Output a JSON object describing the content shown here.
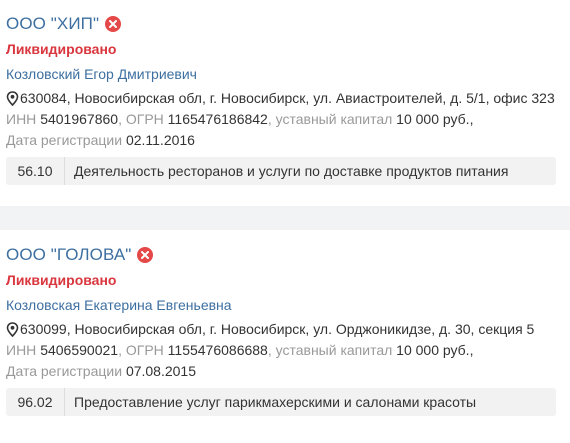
{
  "companies": [
    {
      "name": "ООО \"ХИП\"",
      "status": "Ликвидировано",
      "director": "Козловский Егор Дмитриевич",
      "address": "630084, Новосибирская обл, г. Новосибирск, ул. Авиастроителей, д. 5/1, офис 323",
      "inn_label": "ИНН",
      "inn": "5401967860",
      "ogrn_label": "ОГРН",
      "ogrn": "1165476186842",
      "capital_label": "уставный капитал",
      "capital": "10 000 руб.,",
      "reg_label": "Дата регистрации",
      "reg_date": "02.11.2016",
      "okved_code": "56.10",
      "okved_title": "Деятельность ресторанов и услуги по доставке продуктов питания"
    },
    {
      "name": "ООО \"ГОЛОВА\"",
      "status": "Ликвидировано",
      "director": "Козловская Екатерина Евгеньевна",
      "address": "630099, Новосибирская обл, г. Новосибирск, ул. Орджоникидзе, д. 30, секция 5",
      "inn_label": "ИНН",
      "inn": "5406590021",
      "ogrn_label": "ОГРН",
      "ogrn": "1155476086688",
      "capital_label": "уставный капитал",
      "capital": "10 000 руб.,",
      "reg_label": "Дата регистрации",
      "reg_date": "07.08.2015",
      "okved_code": "96.02",
      "okved_title": "Предоставление услуг парикмахерскими и салонами красоты"
    }
  ],
  "colors": {
    "link": "#3d6fa0",
    "status": "#d9363e",
    "muted": "#999999",
    "badge_bg": "#f2f2f2"
  },
  "icons": {
    "status": "close-circle-icon",
    "address": "map-pin-icon"
  }
}
